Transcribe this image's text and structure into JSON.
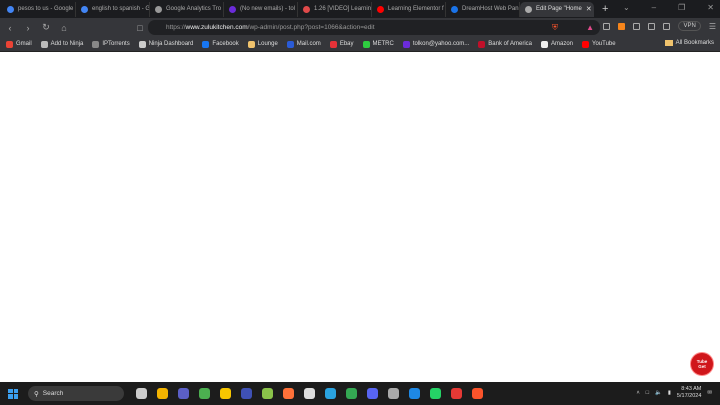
{
  "tabs": [
    {
      "title": "pesos to us - Google",
      "color": "#4285f4",
      "active": false
    },
    {
      "title": "english to spanish - G",
      "color": "#4285f4",
      "active": false
    },
    {
      "title": "Google Analytics Tro",
      "color": "#999999",
      "active": false
    },
    {
      "title": "(No new emails) - tol",
      "color": "#6b2bd9",
      "active": false
    },
    {
      "title": "1.26 [VIDEO] Learnin",
      "color": "#e04a4a",
      "active": false
    },
    {
      "title": "Learning Elementor f",
      "color": "#ff0000",
      "active": false
    },
    {
      "title": "DreamHost Web Pan",
      "color": "#1a73e8",
      "active": false
    },
    {
      "title": "Edit Page \"Home",
      "color": "#aaaaaa",
      "active": true
    }
  ],
  "toolbar": {
    "url_prefix": "https://",
    "url_domain": "www.zulukitchen.com",
    "url_path": "/wp-admin/post.php?post=1066&action=edit",
    "vpn_label": "VPN"
  },
  "bookmarks": [
    {
      "label": "Gmail",
      "color": "#ea4335"
    },
    {
      "label": "Add to Ninja",
      "color": "#bbbbbb"
    },
    {
      "label": "IPTorrents",
      "color": "#888888"
    },
    {
      "label": "Ninja Dashboard",
      "color": "#cccccc"
    },
    {
      "label": "Facebook",
      "color": "#1877f2"
    },
    {
      "label": "Lounge",
      "color": "#f0c36d"
    },
    {
      "label": "Mail.com",
      "color": "#2a5bd7"
    },
    {
      "label": "Ebay",
      "color": "#e53238"
    },
    {
      "label": "METRC",
      "color": "#2ecc40"
    },
    {
      "label": "tolkon@yahoo.com...",
      "color": "#6b2bd9"
    },
    {
      "label": "Bank of America",
      "color": "#c0102a"
    },
    {
      "label": "Amazon",
      "color": "#eeeeee"
    },
    {
      "label": "YouTube",
      "color": "#ff0000"
    }
  ],
  "all_bookmarks": "All Bookmarks",
  "tubeget": {
    "line1": "Tube",
    "line2": "Get"
  },
  "taskbar": {
    "search_placeholder": "Search",
    "time": "8:43 AM",
    "date": "5/17/2024",
    "apps": [
      "#cccccc",
      "#f4b400",
      "#5b5fc7",
      "#4caf50",
      "#f7c600",
      "#3f51b5",
      "#8bc34a",
      "#ff7139",
      "#dddddd",
      "#2aa3e0",
      "#34a853",
      "#5865f2",
      "#aaaaaa",
      "#1e88e5",
      "#25d366",
      "#e53935",
      "#fb542b"
    ]
  }
}
